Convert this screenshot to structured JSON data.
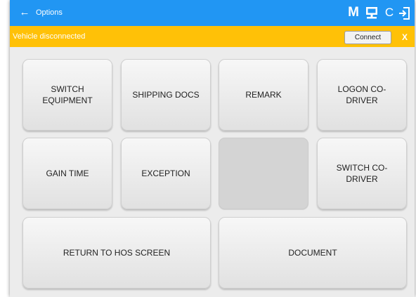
{
  "appbar": {
    "title": "Options",
    "back_icon": "←",
    "m_label": "M",
    "refresh_icon": "C",
    "icons": [
      "back-arrow-icon",
      "m-icon",
      "computer-icon",
      "refresh-icon",
      "logout-icon"
    ],
    "color": "#2196f3"
  },
  "banner": {
    "status_text": "Vehicle disconnected",
    "connect_label": "Connect",
    "close_label": "X",
    "color": "#ffc107"
  },
  "buttons": {
    "switch_equipment": "SWITCH EQUIPMENT",
    "shipping_docs": "SHIPPING DOCS",
    "remark": "REMARK",
    "logon_co_driver": "LOGON CO-DRIVER",
    "gain_time": "GAIN TIME",
    "exception": "EXCEPTION",
    "switch_co_driver": "SWITCH CO-DRIVER",
    "return_to_hos": "RETURN TO HOS SCREEN",
    "document": "DOCUMENT"
  }
}
